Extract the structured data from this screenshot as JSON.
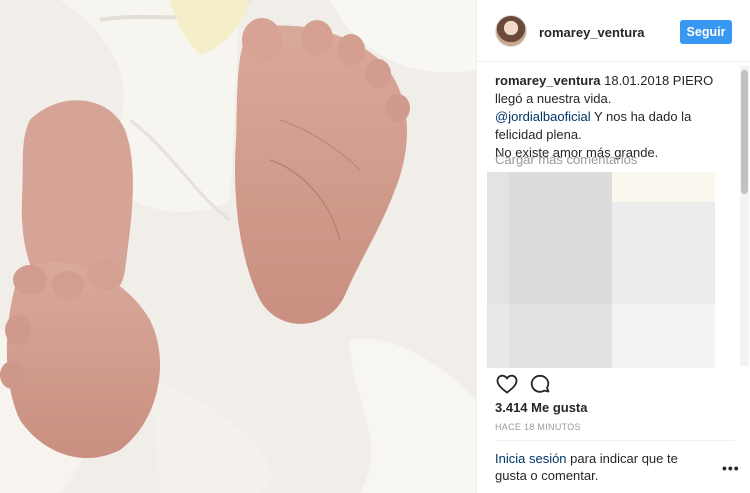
{
  "post": {
    "username": "romarey_ventura",
    "follow_label": "Seguir",
    "caption": {
      "username": "romarey_ventura",
      "text_part1": " 18.01.2018 PIERO llegó a nuestra vida.",
      "mention": "@jordialbaoficial",
      "text_part2": " Y nos ha dado la felicidad plena.",
      "text_part3": "No existe amor más grande."
    },
    "load_more": "Cargar más comentarios",
    "likes": "3.414 Me gusta",
    "timestamp": "HACE 18 MINUTOS",
    "login": {
      "link": "Inicia sesión",
      "text": " para indicar que te gusta o comentar."
    },
    "more_icon": "•••"
  },
  "icons": {
    "like": "heart-icon",
    "comment": "comment-icon",
    "more": "more-options-icon"
  }
}
